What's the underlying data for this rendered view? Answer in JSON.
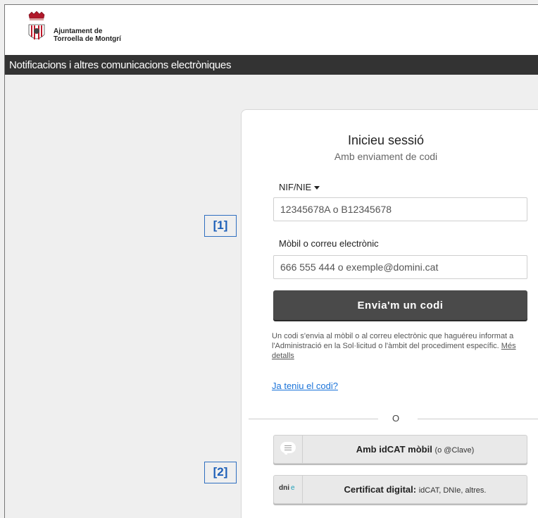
{
  "brand": {
    "name_line1": "Ajuntament de",
    "name_line2": "Torroella de Montgrí"
  },
  "header": {
    "title": "Notificacions i altres comunicacions electròniques"
  },
  "login": {
    "title": "Inicieu sessió",
    "subtitle": "Amb enviament de codi",
    "id_type_label": "NIF/NIE",
    "id_placeholder": "12345678A o B12345678",
    "contact_label": "Mòbil o correu electrònic",
    "contact_placeholder": "666 555 444 o exemple@domini.cat",
    "send_button": "Envia'm un codi",
    "info_text": "Un codi s'envia al mòbil o al correu electrònic que haguéreu informat a l'Administració en la Sol·licitud o l'àmbit del procediment específic.",
    "info_link": "Més detalls",
    "have_code_link": "Ja teniu el codi?",
    "divider_text": "O"
  },
  "alternatives": {
    "idcat_bold": "Amb idCAT mòbil",
    "idcat_small": "(o @Clave)",
    "cert_bold": "Certificat digital:",
    "cert_small": "idCAT, DNIe, altres.",
    "dni_logo_text": "dni",
    "dni_logo_mark": "e"
  },
  "annotations": {
    "first": "[1]",
    "second": "[2]"
  },
  "colors": {
    "header_bg": "#333333",
    "primary_button": "#4a4a4a",
    "link": "#1a73d9",
    "annotation": "#2f6fc0",
    "crest_red": "#c0182a"
  }
}
